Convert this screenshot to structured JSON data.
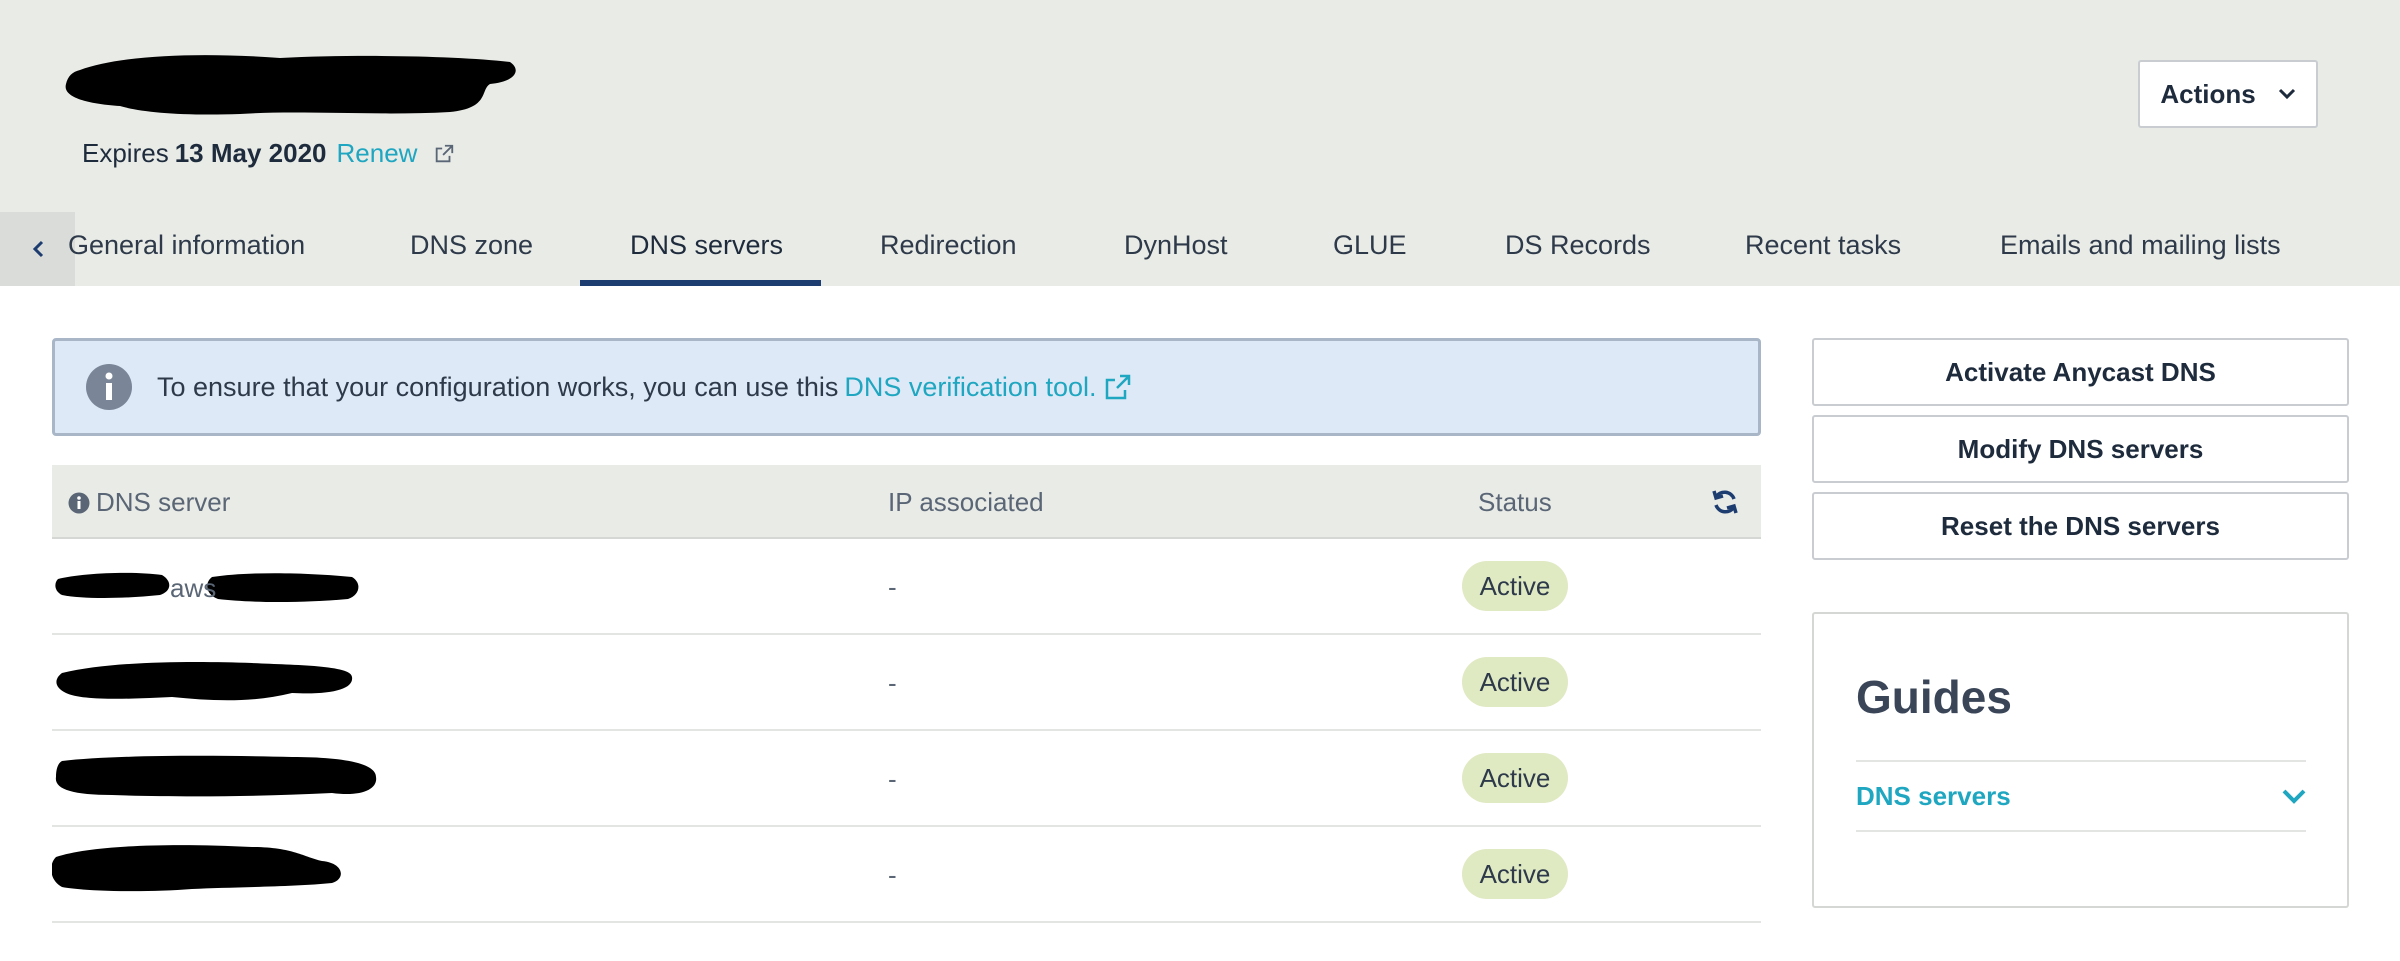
{
  "header": {
    "expires_label": "Expires",
    "expires_date": "13 May 2020",
    "renew_label": "Renew",
    "actions_label": "Actions"
  },
  "tabs": [
    {
      "label": "General information"
    },
    {
      "label": "DNS zone"
    },
    {
      "label": "DNS servers",
      "active": true
    },
    {
      "label": "Redirection"
    },
    {
      "label": "DynHost"
    },
    {
      "label": "GLUE"
    },
    {
      "label": "DS Records"
    },
    {
      "label": "Recent tasks"
    },
    {
      "label": "Emails and mailing lists"
    }
  ],
  "info_banner": {
    "text": "To ensure that your configuration works, you can use this",
    "link_label": "DNS verification tool."
  },
  "table": {
    "headers": {
      "dns_server": "DNS server",
      "ip": "IP associated",
      "status": "Status"
    },
    "rows": [
      {
        "dns_visible_fragment": "aws",
        "ip": "-",
        "status": "Active"
      },
      {
        "dns_visible_fragment": "",
        "ip": "-",
        "status": "Active"
      },
      {
        "dns_visible_fragment": "",
        "ip": "-",
        "status": "Active"
      },
      {
        "dns_visible_fragment": "",
        "ip": "-",
        "status": "Active"
      }
    ]
  },
  "side_actions": {
    "activate_anycast": "Activate Anycast DNS",
    "modify_dns": "Modify DNS servers",
    "reset_dns": "Reset the DNS servers"
  },
  "guides": {
    "title": "Guides",
    "item_label": "DNS servers"
  },
  "colors": {
    "accent_link": "#1fa6c0",
    "tab_underline": "#1d3d70",
    "header_bg": "#e9ebe7",
    "info_bg": "#dde9f6",
    "badge_bg": "#dfe9c2"
  }
}
